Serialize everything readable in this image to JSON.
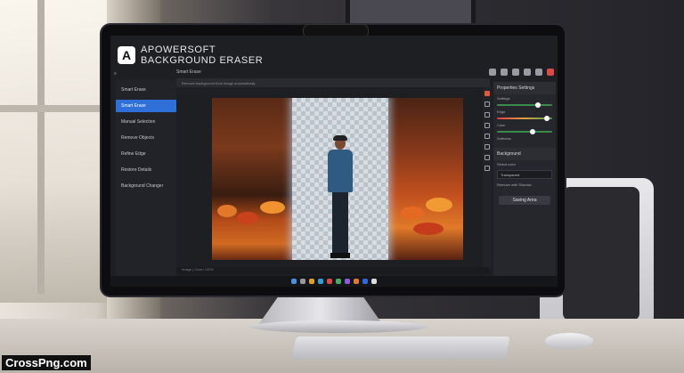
{
  "app": {
    "logo_letter": "A",
    "brand_line1": "APOWERSOFT",
    "brand_line2": "BACKGROUND ERASER",
    "menu_glyph": "≡"
  },
  "sidebar": {
    "items": [
      {
        "label": "Smart Erase",
        "active": false
      },
      {
        "label": "Smart Erase",
        "active": true
      },
      {
        "label": "Manual Selection",
        "active": false
      },
      {
        "label": "Remove Objects",
        "active": false
      },
      {
        "label": "Refine Edge",
        "active": false
      },
      {
        "label": "Restore Details",
        "active": false
      },
      {
        "label": "Background Changer",
        "active": false
      }
    ]
  },
  "header": {
    "breadcrumb": "Smart Erase",
    "path": "Remove background from image automatically"
  },
  "panel": {
    "title": "Properties Settings",
    "rows": [
      {
        "label": "Settings"
      },
      {
        "label": "Edge"
      },
      {
        "label": "Color"
      },
      {
        "label": "Softness"
      }
    ],
    "section": "Background",
    "select_label": "Select color",
    "select_value": "Transparent",
    "sub_label": "Remove with Shadow",
    "button": "Saving Area"
  },
  "status": {
    "text": "Image  |  Zoom  100%"
  },
  "accent_color": "#2e6fd8",
  "watermark": "CrossPng.com",
  "icons": [
    "menu-icon",
    "close-icon",
    "brush-icon",
    "eraser-icon",
    "zoom-icon",
    "hand-icon",
    "undo-icon",
    "redo-icon"
  ]
}
